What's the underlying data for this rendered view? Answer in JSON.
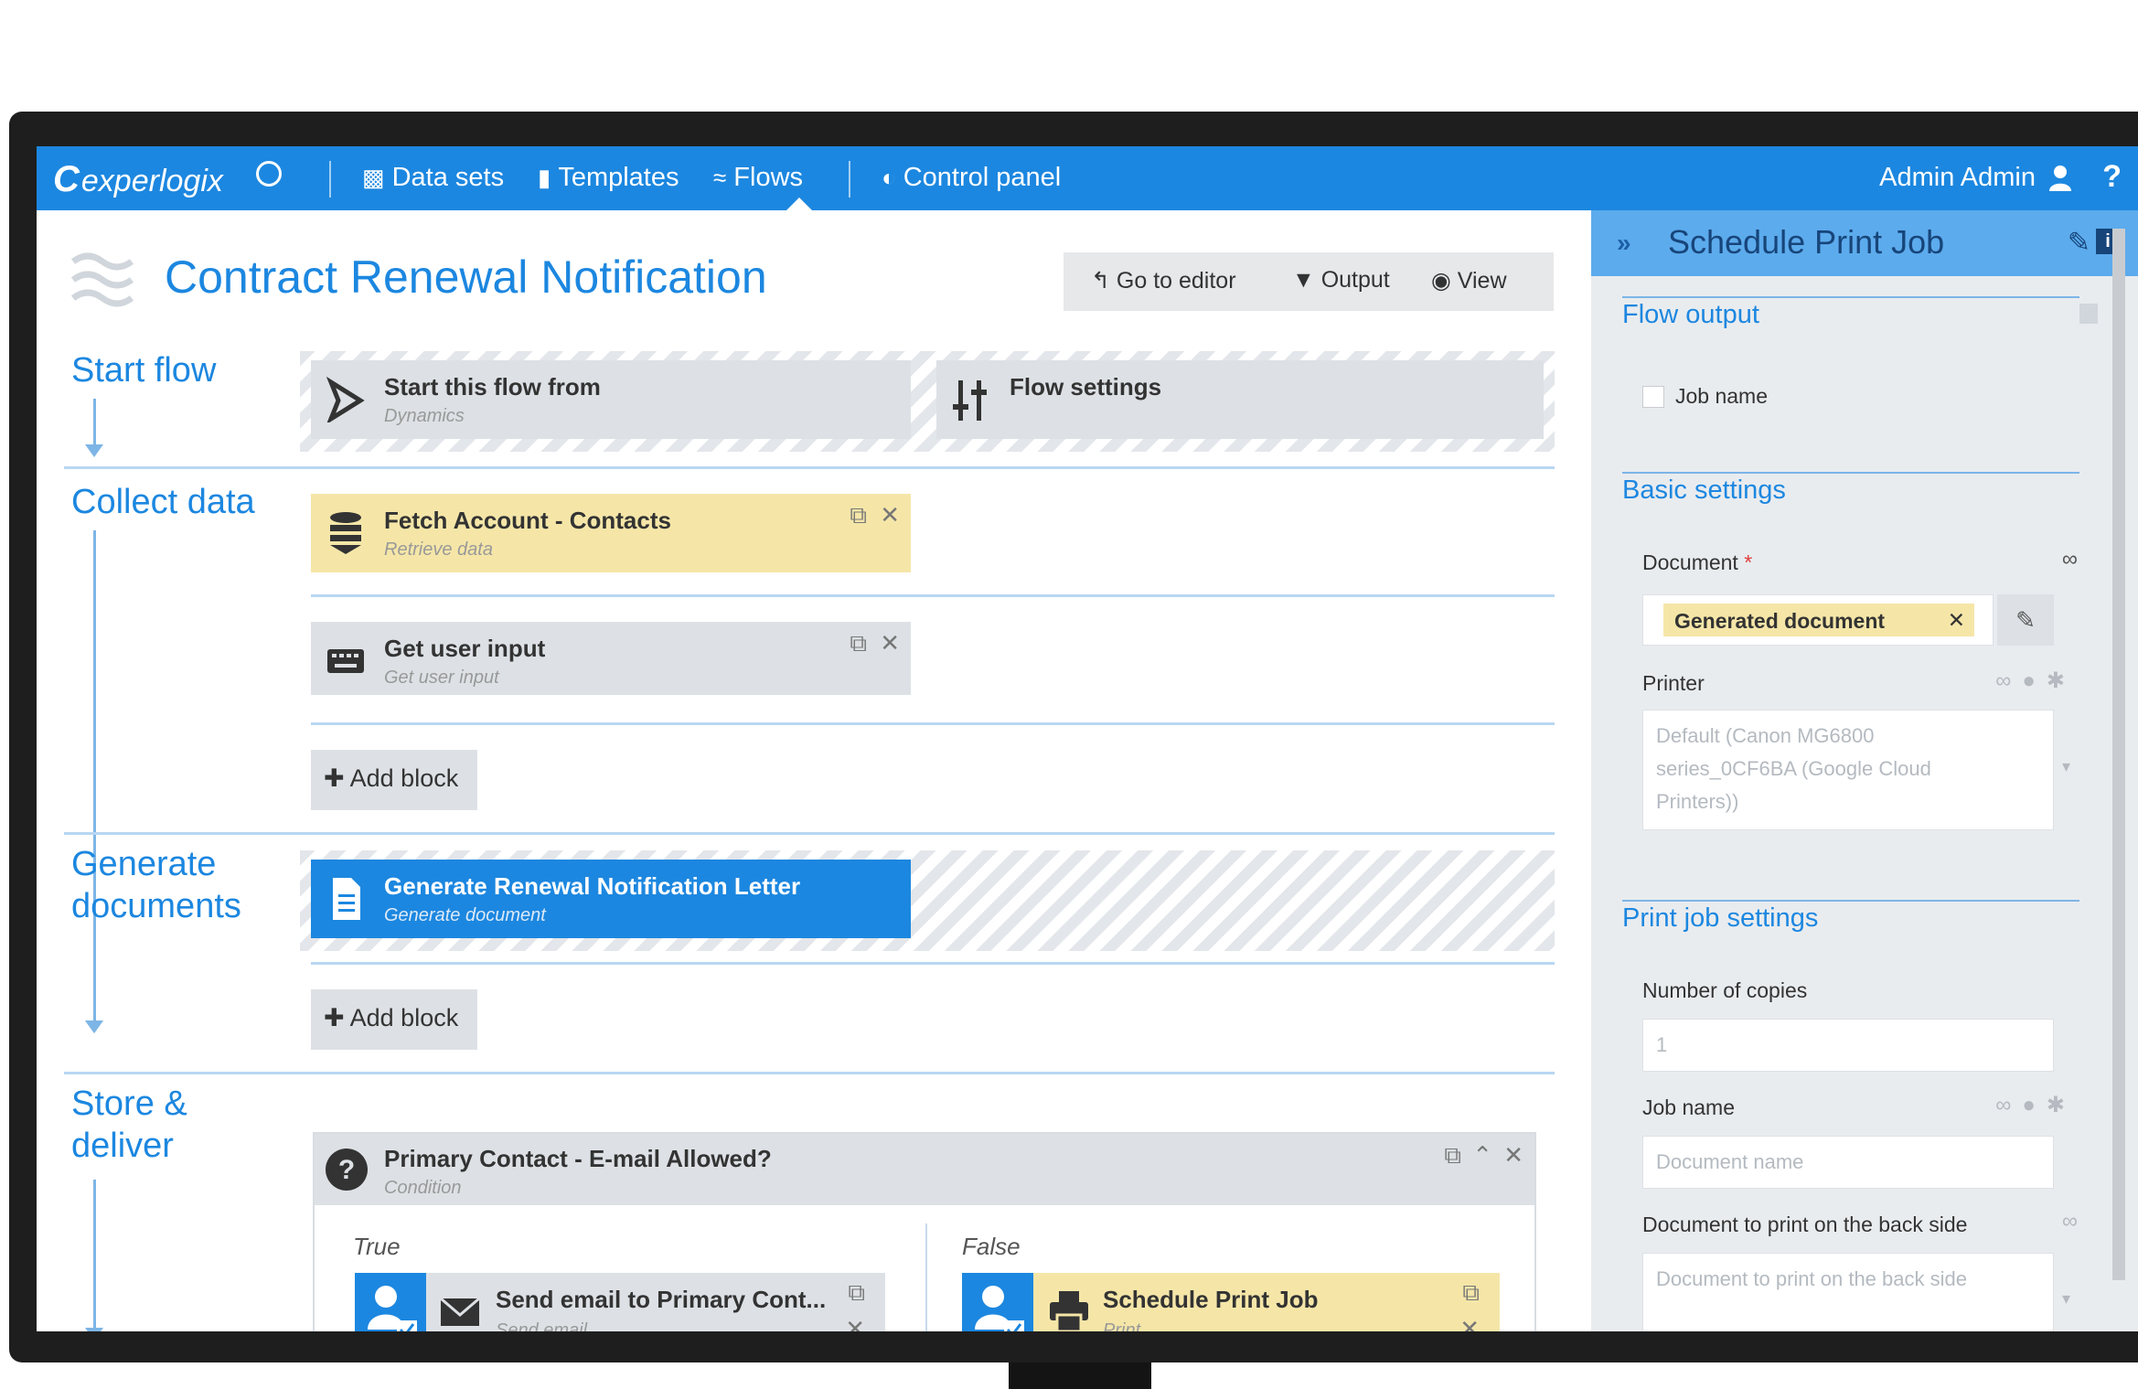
{
  "nav": {
    "logo": "experlogix",
    "items": [
      {
        "label": "Data sets"
      },
      {
        "label": "Templates"
      },
      {
        "label": "Flows"
      },
      {
        "label": "Control panel"
      }
    ],
    "user": "Admin Admin",
    "help": "?"
  },
  "page": {
    "title": "Contract Renewal Notification",
    "toolbar": {
      "editor": "Go to editor",
      "output": "Output",
      "view": "View"
    }
  },
  "stages": {
    "start": "Start flow",
    "collect": "Collect data",
    "generate_line1": "Generate",
    "generate_line2": "documents",
    "store_line1": "Store &",
    "store_line2": "deliver"
  },
  "blocks": {
    "start_from": {
      "title": "Start this flow from",
      "sub": "Dynamics"
    },
    "flow_settings": {
      "title": "Flow settings"
    },
    "fetch": {
      "title": "Fetch Account - Contacts",
      "sub": "Retrieve data"
    },
    "user_input": {
      "title": "Get user input",
      "sub": "Get user input"
    },
    "add_block_1": "Add block",
    "generate": {
      "title": "Generate Renewal Notification Letter",
      "sub": "Generate document"
    },
    "add_block_2": "Add block",
    "condition": {
      "title": "Primary Contact - E-mail Allowed?",
      "sub": "Condition",
      "true_label": "True",
      "false_label": "False"
    },
    "send_email": {
      "title": "Send email to Primary Cont...",
      "sub": "Send email"
    },
    "schedule": {
      "title": "Schedule Print Job",
      "sub": "Print"
    }
  },
  "panel": {
    "title": "Schedule Print Job",
    "flow_output": {
      "heading": "Flow output",
      "job_name_checkbox": "Job name",
      "checked": false
    },
    "basic": {
      "heading": "Basic settings",
      "document_label": "Document",
      "required_mark": "*",
      "document_value": "Generated document",
      "printer_label": "Printer",
      "printer_value": "Default (Canon MG6800 series_0CF6BA (Google Cloud Printers))"
    },
    "print_job": {
      "heading": "Print job settings",
      "copies_label": "Number of copies",
      "copies_placeholder": "1",
      "job_name_label": "Job name",
      "job_name_placeholder": "Document name",
      "back_label": "Document to print on the back side",
      "back_placeholder": "Document to print on the back side"
    }
  },
  "colors": {
    "brand": "#1c87e0",
    "selected_block": "#1c87e0",
    "highlight": "#f5e6a8"
  }
}
